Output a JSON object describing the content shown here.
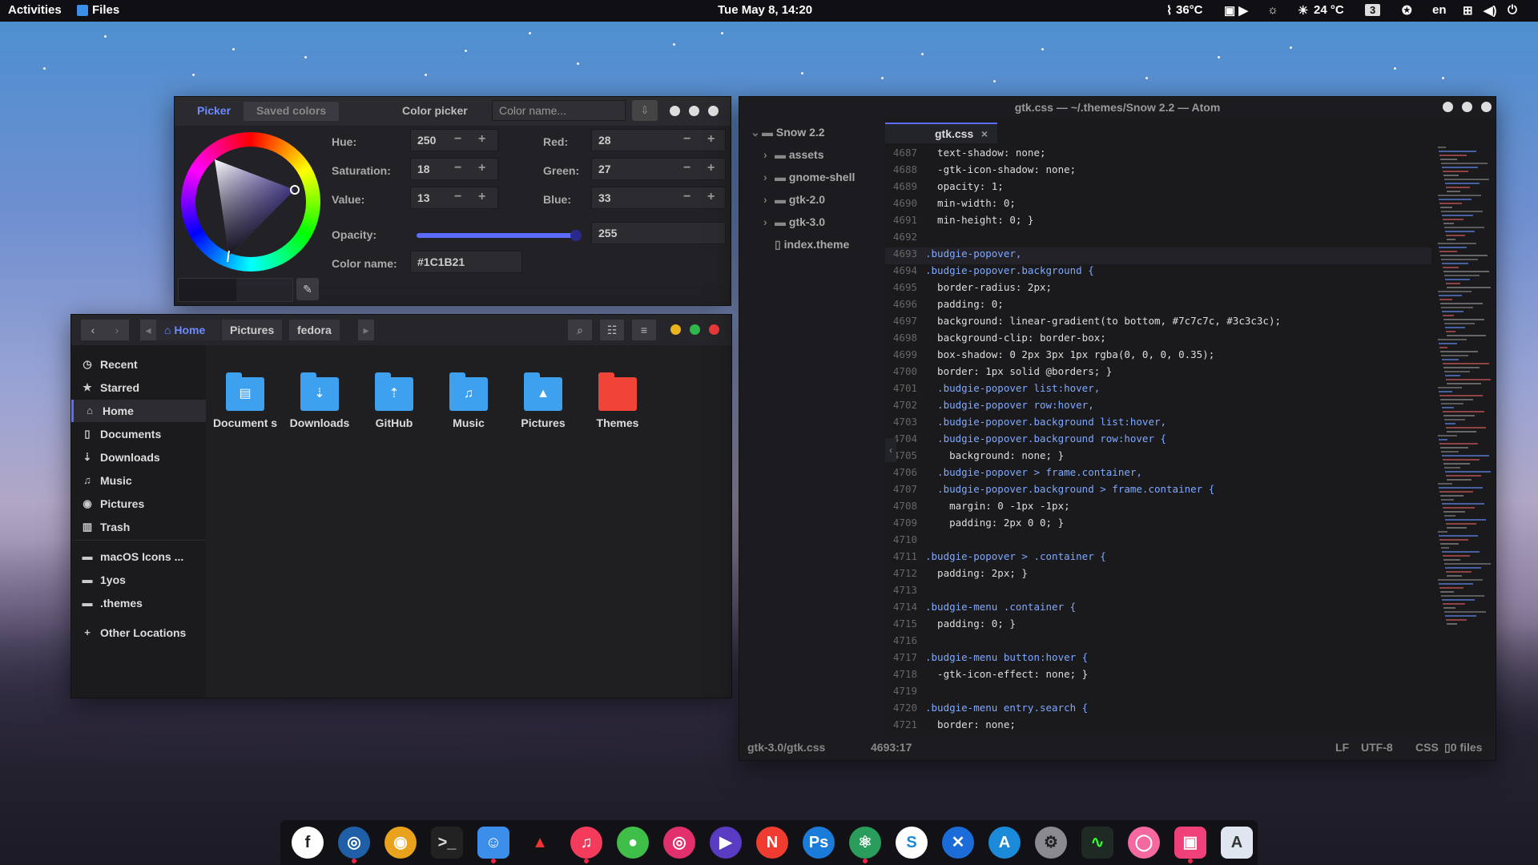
{
  "topbar": {
    "activities": "Activities",
    "app": "Files",
    "clock": "Tue May 8, 14:20",
    "cpu_temp": "36°C",
    "weather": "24 °C",
    "workspace": "3",
    "lang": "en"
  },
  "color_picker": {
    "tab_picker": "Picker",
    "tab_saved": "Saved colors",
    "title": "Color picker",
    "name_placeholder": "Color name...",
    "hue_label": "Hue:",
    "hue": "250",
    "sat_label": "Saturation:",
    "sat": "18",
    "val_label": "Value:",
    "val": "13",
    "red_label": "Red:",
    "red": "28",
    "green_label": "Green:",
    "green": "27",
    "blue_label": "Blue:",
    "blue": "33",
    "opacity_label": "Opacity:",
    "opacity": "255",
    "opacity_fraction": 1.0,
    "colorname_label": "Color name:",
    "colorname": "#1C1B21",
    "minus": "−",
    "plus": "+"
  },
  "files": {
    "breadcrumb": [
      "Home",
      "Pictures",
      "fedora"
    ],
    "sidebar": [
      {
        "label": "Recent",
        "icon": "clock-icon",
        "glyph": "◷"
      },
      {
        "label": "Starred",
        "icon": "star-icon",
        "glyph": "★"
      },
      {
        "label": "Home",
        "icon": "home-icon",
        "glyph": "⌂"
      },
      {
        "label": "Documents",
        "icon": "document-icon",
        "glyph": "▯"
      },
      {
        "label": "Downloads",
        "icon": "download-icon",
        "glyph": "⇣"
      },
      {
        "label": "Music",
        "icon": "music-icon",
        "glyph": "♫"
      },
      {
        "label": "Pictures",
        "icon": "camera-icon",
        "glyph": "◉"
      },
      {
        "label": "Trash",
        "icon": "trash-icon",
        "glyph": "▥"
      },
      {
        "label": "macOS Icons ...",
        "icon": "folder-icon",
        "glyph": "▬"
      },
      {
        "label": "1yos",
        "icon": "folder-icon",
        "glyph": "▬"
      },
      {
        "label": ".themes",
        "icon": "folder-icon",
        "glyph": "▬"
      },
      {
        "label": "Other Locations",
        "icon": "plus-icon",
        "glyph": "+"
      }
    ],
    "folders": [
      {
        "label": "Document s",
        "color": "#3ea1f0",
        "glyph": "▤"
      },
      {
        "label": "Downloads",
        "color": "#3ea1f0",
        "glyph": "⇣"
      },
      {
        "label": "GitHub",
        "color": "#3ea1f0",
        "glyph": "⇡"
      },
      {
        "label": "Music",
        "color": "#3ea1f0",
        "glyph": "♫"
      },
      {
        "label": "Pictures",
        "color": "#3ea1f0",
        "glyph": "▲"
      },
      {
        "label": "Themes",
        "color": "#f04438",
        "glyph": ""
      }
    ]
  },
  "atom": {
    "title": "gtk.css — ~/.themes/Snow 2.2 — Atom",
    "tree": [
      {
        "label": "Snow 2.2",
        "arrow": "⌄",
        "type": "folder"
      },
      {
        "label": "assets",
        "arrow": "›",
        "type": "folder"
      },
      {
        "label": "gnome-shell",
        "arrow": "›",
        "type": "folder"
      },
      {
        "label": "gtk-2.0",
        "arrow": "›",
        "type": "folder"
      },
      {
        "label": "gtk-3.0",
        "arrow": "›",
        "type": "folder"
      },
      {
        "label": "index.theme",
        "arrow": "",
        "type": "file"
      }
    ],
    "tab": "gtk.css",
    "tab_close": "×",
    "lines": [
      {
        "n": "4687",
        "t": "  text-shadow: none;"
      },
      {
        "n": "4688",
        "t": "  -gtk-icon-shadow: none;"
      },
      {
        "n": "4689",
        "t": "  opacity: 1;"
      },
      {
        "n": "4690",
        "t": "  min-width: 0;"
      },
      {
        "n": "4691",
        "t": "  min-height: 0; }"
      },
      {
        "n": "4692",
        "t": ""
      },
      {
        "n": "4693",
        "t": ".budgie-popover,"
      },
      {
        "n": "4694",
        "t": ".budgie-popover.background {"
      },
      {
        "n": "4695",
        "t": "  border-radius: 2px;"
      },
      {
        "n": "4696",
        "t": "  padding: 0;"
      },
      {
        "n": "4697",
        "t": "  background: linear-gradient(to bottom, #7c7c7c, #3c3c3c);"
      },
      {
        "n": "4698",
        "t": "  background-clip: border-box;"
      },
      {
        "n": "4699",
        "t": "  box-shadow: 0 2px 3px 1px rgba(0, 0, 0, 0.35);"
      },
      {
        "n": "4700",
        "t": "  border: 1px solid @borders; }"
      },
      {
        "n": "4701",
        "t": "  .budgie-popover list:hover,"
      },
      {
        "n": "4702",
        "t": "  .budgie-popover row:hover,"
      },
      {
        "n": "4703",
        "t": "  .budgie-popover.background list:hover,"
      },
      {
        "n": "4704",
        "t": "  .budgie-popover.background row:hover {"
      },
      {
        "n": "4705",
        "t": "    background: none; }"
      },
      {
        "n": "4706",
        "t": "  .budgie-popover > frame.container,"
      },
      {
        "n": "4707",
        "t": "  .budgie-popover.background > frame.container {"
      },
      {
        "n": "4708",
        "t": "    margin: 0 -1px -1px;"
      },
      {
        "n": "4709",
        "t": "    padding: 2px 0 0; }"
      },
      {
        "n": "4710",
        "t": ""
      },
      {
        "n": "4711",
        "t": ".budgie-popover > .container {"
      },
      {
        "n": "4712",
        "t": "  padding: 2px; }"
      },
      {
        "n": "4713",
        "t": ""
      },
      {
        "n": "4714",
        "t": ".budgie-menu .container {"
      },
      {
        "n": "4715",
        "t": "  padding: 0; }"
      },
      {
        "n": "4716",
        "t": ""
      },
      {
        "n": "4717",
        "t": ".budgie-menu button:hover {"
      },
      {
        "n": "4718",
        "t": "  -gtk-icon-effect: none; }"
      },
      {
        "n": "4719",
        "t": ""
      },
      {
        "n": "4720",
        "t": ".budgie-menu entry.search {"
      },
      {
        "n": "4721",
        "t": "  border: none;"
      }
    ],
    "status_path": "gtk-3.0/gtk.css",
    "status_pos": "4693:17",
    "status_lf": "LF",
    "status_enc": "UTF-8",
    "status_lang": "CSS",
    "status_files": "0 files"
  },
  "dock": [
    {
      "name": "fedora-icon",
      "bg": "#ffffff",
      "fg": "#222",
      "glyph": "f",
      "running": false
    },
    {
      "name": "safari-icon",
      "bg": "#1f5fa8",
      "fg": "#fff",
      "glyph": "◎",
      "running": true
    },
    {
      "name": "chrome-icon",
      "bg": "#e8a21c",
      "fg": "#fff",
      "glyph": "◉",
      "running": false
    },
    {
      "name": "terminal-icon",
      "bg": "#222",
      "fg": "#ddd",
      "glyph": ">_",
      "running": false
    },
    {
      "name": "finder-icon",
      "bg": "#3b8eea",
      "fg": "#fff",
      "glyph": "☺",
      "running": true
    },
    {
      "name": "migrate-icon",
      "bg": "#121216",
      "fg": "#e33",
      "glyph": "▲",
      "running": false
    },
    {
      "name": "music-icon",
      "bg": "#f43b5c",
      "fg": "#fff",
      "glyph": "♫",
      "running": true
    },
    {
      "name": "messages-icon",
      "bg": "#3fbf4a",
      "fg": "#fff",
      "glyph": "●",
      "running": false
    },
    {
      "name": "instagram-icon",
      "bg": "#e1306c",
      "fg": "#fff",
      "glyph": "◎",
      "running": false
    },
    {
      "name": "video-player-icon",
      "bg": "#5a3cc4",
      "fg": "#fff",
      "glyph": "▶",
      "running": false
    },
    {
      "name": "news-icon",
      "bg": "#f03b30",
      "fg": "#fff",
      "glyph": "N",
      "running": false
    },
    {
      "name": "photoshop-icon",
      "bg": "#1b7bd8",
      "fg": "#fff",
      "glyph": "Ps",
      "running": false
    },
    {
      "name": "atom-icon",
      "bg": "#2a9d5c",
      "fg": "#fff",
      "glyph": "⚛",
      "running": true
    },
    {
      "name": "skype-icon",
      "bg": "#ffffff",
      "fg": "#1b8ad8",
      "glyph": "S",
      "running": false
    },
    {
      "name": "xcode-icon",
      "bg": "#1b6bd8",
      "fg": "#fff",
      "glyph": "✕",
      "running": false
    },
    {
      "name": "app-store-icon",
      "bg": "#1b8ad8",
      "fg": "#fff",
      "glyph": "A",
      "running": false
    },
    {
      "name": "settings-icon",
      "bg": "#8a8a90",
      "fg": "#222",
      "glyph": "⚙",
      "running": false
    },
    {
      "name": "activity-monitor-icon",
      "bg": "#1f2a24",
      "fg": "#3f3",
      "glyph": "∿",
      "running": false
    },
    {
      "name": "music-alt-icon",
      "bg": "#f46aa0",
      "fg": "#fff",
      "glyph": "◯",
      "running": false
    },
    {
      "name": "screenshot-icon",
      "bg": "#f0407a",
      "fg": "#fff",
      "glyph": "▣",
      "running": true
    },
    {
      "name": "text-editor-icon",
      "bg": "#dfe6ef",
      "fg": "#333",
      "glyph": "A",
      "running": false
    }
  ]
}
